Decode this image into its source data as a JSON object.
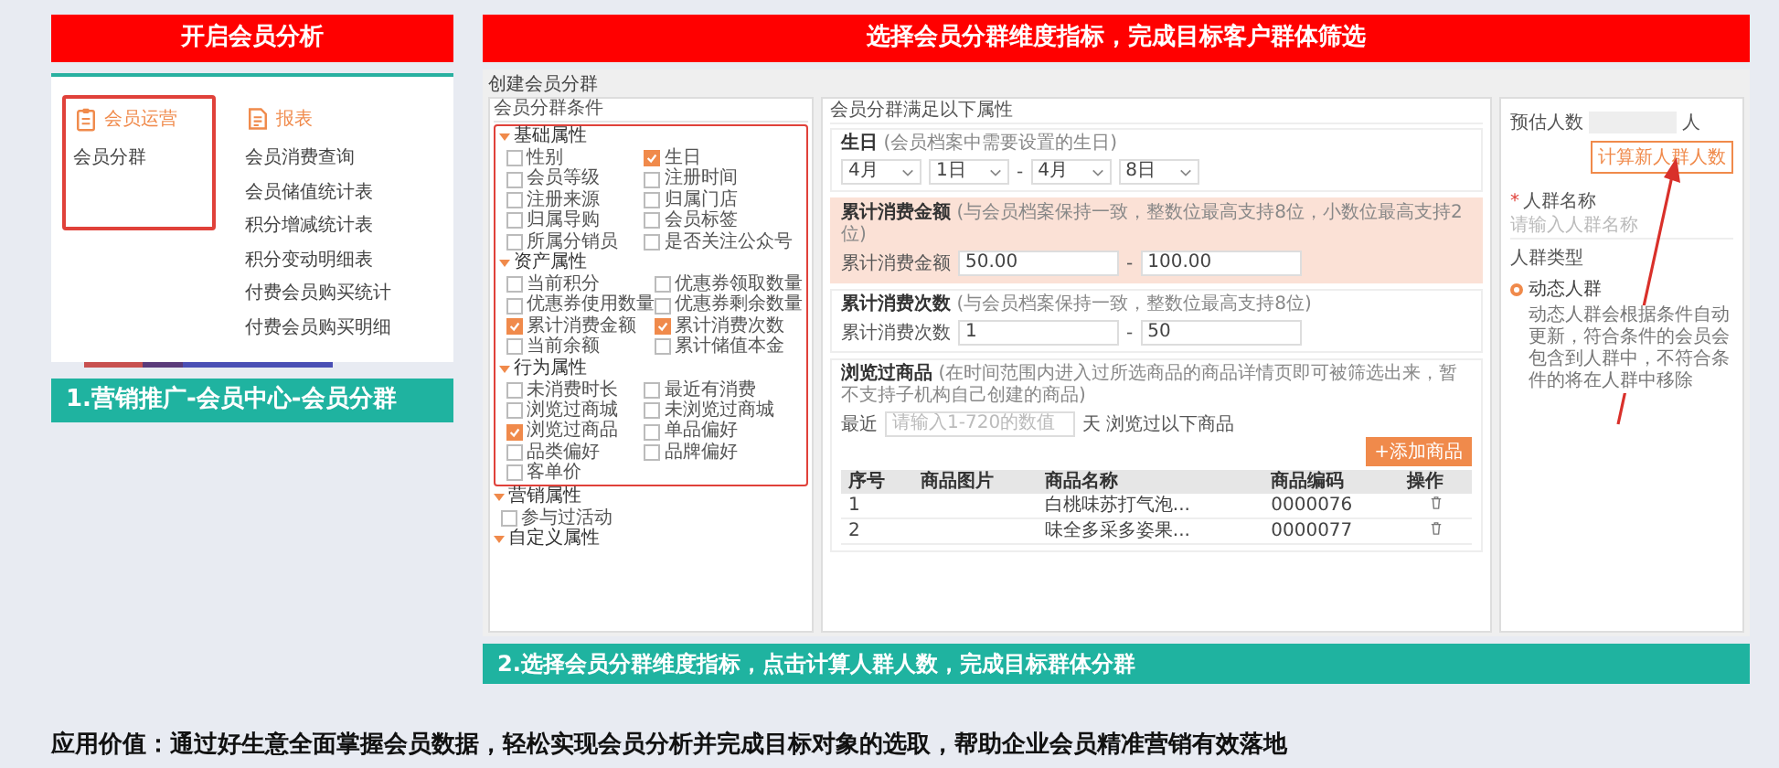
{
  "intro": {
    "title": "开启会员分析",
    "menu_groups": [
      {
        "title": "会员运营",
        "highlighted": true,
        "items": [
          "会员分群"
        ]
      },
      {
        "title": "报表",
        "highlighted": false,
        "items": [
          "会员消费查询",
          "会员储值统计表",
          "积分增减统计表",
          "积分变动明细表",
          "付费会员购买统计",
          "付费会员购买明细"
        ]
      }
    ],
    "caption": "1.营销推广-会员中心-会员分群"
  },
  "main": {
    "title": "选择会员分群维度指标，完成目标客户群体筛选",
    "page_title": "创建会员分群",
    "conditions": {
      "header": "会员分群条件",
      "groups": [
        {
          "name": "基础属性",
          "highlighted": true,
          "options": [
            {
              "label": "性别",
              "checked": false
            },
            {
              "label": "生日",
              "checked": true
            },
            {
              "label": "会员等级",
              "checked": false
            },
            {
              "label": "注册时间",
              "checked": false
            },
            {
              "label": "注册来源",
              "checked": false
            },
            {
              "label": "归属门店",
              "checked": false
            },
            {
              "label": "归属导购",
              "checked": false
            },
            {
              "label": "会员标签",
              "checked": false
            },
            {
              "label": "所属分销员",
              "checked": false
            },
            {
              "label": "是否关注公众号",
              "checked": false
            }
          ]
        },
        {
          "name": "资产属性",
          "highlighted": true,
          "options": [
            {
              "label": "当前积分",
              "checked": false
            },
            {
              "label": "优惠券领取数量",
              "checked": false
            },
            {
              "label": "优惠券使用数量",
              "checked": false
            },
            {
              "label": "优惠券剩余数量",
              "checked": false
            },
            {
              "label": "累计消费金额",
              "checked": true
            },
            {
              "label": "累计消费次数",
              "checked": true
            },
            {
              "label": "当前余额",
              "checked": false
            },
            {
              "label": "累计储值本金",
              "checked": false
            }
          ]
        },
        {
          "name": "行为属性",
          "highlighted": true,
          "options": [
            {
              "label": "未消费时长",
              "checked": false
            },
            {
              "label": "最近有消费",
              "checked": false
            },
            {
              "label": "浏览过商城",
              "checked": false
            },
            {
              "label": "未浏览过商城",
              "checked": false
            },
            {
              "label": "浏览过商品",
              "checked": true
            },
            {
              "label": "单品偏好",
              "checked": false
            },
            {
              "label": "品类偏好",
              "checked": false
            },
            {
              "label": "品牌偏好",
              "checked": false
            },
            {
              "label": "客单价",
              "checked": false
            }
          ]
        },
        {
          "name": "营销属性",
          "highlighted": false,
          "options": [
            {
              "label": "参与过活动",
              "checked": false
            }
          ]
        },
        {
          "name": "自定义属性",
          "highlighted": false
        }
      ]
    },
    "filters_title": "会员分群满足以下属性",
    "filters": [
      {
        "kind": "date_range",
        "title": "生日",
        "hint": "(会员档案中需要设置的生日)",
        "selected": false,
        "values": [
          "4月",
          "1日",
          "4月",
          "8日"
        ],
        "separator": "-"
      },
      {
        "kind": "number_range",
        "title": "累计消费金额",
        "hint": "(与会员档案保持一致，整数位最高支持8位，小数位最高支持2位)",
        "selected": true,
        "label": "累计消费金额",
        "from": "50.00",
        "to": "100.00",
        "separator": "-"
      },
      {
        "kind": "number_range",
        "title": "累计消费次数",
        "hint": "(与会员档案保持一致，整数位最高支持8位)",
        "selected": false,
        "label": "累计消费次数",
        "from": "1",
        "to": "50",
        "separator": "-"
      },
      {
        "kind": "products",
        "title": "浏览过商品",
        "hint": "(在时间范围内进入过所选商品的商品详情页即可被筛选出来，暂不支持子机构自己创建的商品)",
        "selected": false,
        "prefix": "最近",
        "placeholder": "请输入1-720的数值",
        "suffix": "天 浏览过以下商品",
        "add_button": "+添加商品",
        "columns": [
          "序号",
          "商品图片",
          "商品名称",
          "商品编码",
          "操作"
        ],
        "rows": [
          {
            "index": "1",
            "name": "白桃味苏打气泡...",
            "code": "0000076"
          },
          {
            "index": "2",
            "name": "味全多采多姿果...",
            "code": "0000077"
          }
        ]
      }
    ],
    "summary": {
      "estimate_label": "预估人数",
      "unit": "人",
      "calc_button": "计算新人群人数",
      "name_label": "人群名称",
      "name_required_mark": "*",
      "name_placeholder": "请输入人群名称",
      "type_label": "人群类型",
      "type_options": [
        {
          "label": "动态人群",
          "selected": true
        }
      ],
      "type_description": "动态人群会根据条件自动更新，符合条件的会员会包含到人群中，不符合条件的将在人群中移除"
    },
    "caption": "2.选择会员分群维度指标，点击计算人群人数，完成目标群体分群"
  },
  "footer": "应用价值：通过好生意全面掌握会员数据，轻松实现会员分析并完成目标对象的选取，帮助企业会员精准营销有效落地"
}
